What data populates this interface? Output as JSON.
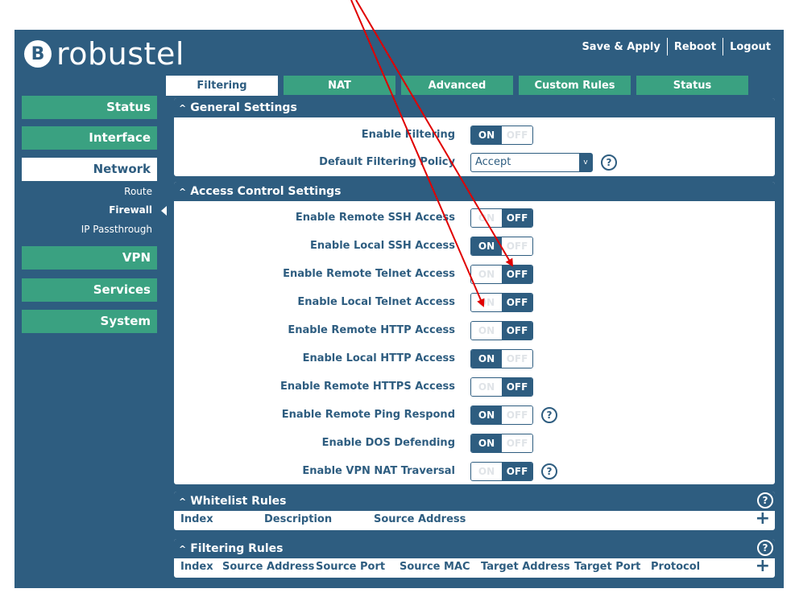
{
  "header": {
    "logo_mark": "B",
    "logo_text": "robustel",
    "save_apply": "Save & Apply",
    "reboot": "Reboot",
    "logout": "Logout"
  },
  "tabs": [
    {
      "label": "Filtering",
      "active": true
    },
    {
      "label": "NAT",
      "active": false
    },
    {
      "label": "Advanced",
      "active": false
    },
    {
      "label": "Custom Rules",
      "active": false
    },
    {
      "label": "Status",
      "active": false
    }
  ],
  "sidebar": {
    "status": "Status",
    "interface": "Interface",
    "network": "Network",
    "route": "Route",
    "firewall": "Firewall",
    "ip_passthrough": "IP Passthrough",
    "vpn": "VPN",
    "services": "Services",
    "system": "System"
  },
  "general": {
    "title": "General Settings",
    "enable_filtering": {
      "label": "Enable Filtering",
      "state": "on"
    },
    "default_policy": {
      "label": "Default Filtering Policy",
      "value": "Accept",
      "arrow": "v"
    }
  },
  "access": {
    "title": "Access Control Settings",
    "rows": [
      {
        "label": "Enable Remote SSH Access",
        "state": "off"
      },
      {
        "label": "Enable Local SSH Access",
        "state": "on"
      },
      {
        "label": "Enable Remote Telnet Access",
        "state": "off"
      },
      {
        "label": "Enable Local Telnet Access",
        "state": "off"
      },
      {
        "label": "Enable Remote HTTP Access",
        "state": "off"
      },
      {
        "label": "Enable Local HTTP Access",
        "state": "on"
      },
      {
        "label": "Enable Remote HTTPS Access",
        "state": "off"
      },
      {
        "label": "Enable Remote Ping Respond",
        "state": "on",
        "help": true
      },
      {
        "label": "Enable DOS Defending",
        "state": "on"
      },
      {
        "label": "Enable VPN NAT Traversal",
        "state": "off",
        "help": true
      }
    ]
  },
  "toggle_text": {
    "on": "ON",
    "off": "OFF"
  },
  "help_glyph": "?",
  "caret_glyph": "^",
  "whitelist": {
    "title": "Whitelist Rules",
    "columns": [
      "Index",
      "Description",
      "Source Address"
    ]
  },
  "filtering_rules": {
    "title": "Filtering Rules",
    "columns": [
      "Index",
      "Source Address",
      "Source Port",
      "Source MAC",
      "Target Address",
      "Target Port",
      "Protocol"
    ]
  },
  "plus_glyph": "+",
  "colors": {
    "brand_blue": "#2e5d80",
    "accent_green": "#3aa181",
    "annotation_red": "#e00000"
  }
}
